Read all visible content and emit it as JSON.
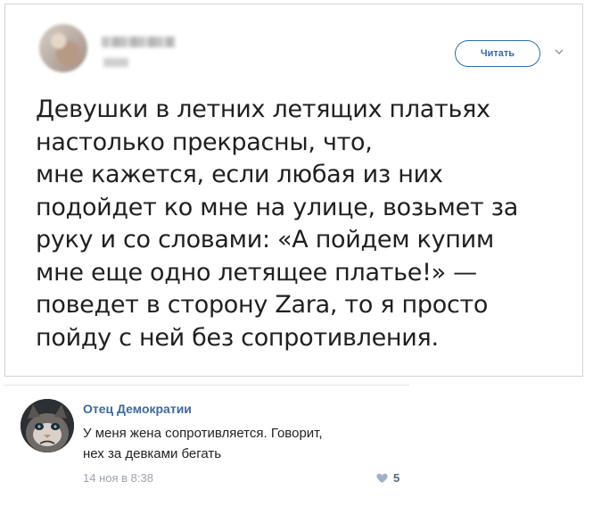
{
  "tweet": {
    "follow_label": "Читать",
    "icons": {
      "menu": "chevron-down-icon"
    },
    "text_lines": [
      "Девушки в летних летящих платьях",
      "настолько прекрасны, что,",
      "мне кажется, если любая из них",
      "подойдет ко мне на улице, возьмет за",
      "руку и со словами: «А пойдем купим",
      "мне еще одно летящее платье!» —",
      "поведет в сторону Zara, то я просто",
      "пойду с ней без сопротивления."
    ]
  },
  "comment": {
    "author": "Отец Демократии",
    "text_lines": [
      "У меня жена сопротивляется. Говорит,",
      "нех за девками бегать"
    ],
    "date": "14 ноя в 8:38",
    "likes": "5",
    "icons": {
      "like": "heart-icon"
    }
  },
  "colors": {
    "accent": "#2f6da8",
    "author": "#3c6b9c",
    "meta": "#9aa3ad"
  }
}
